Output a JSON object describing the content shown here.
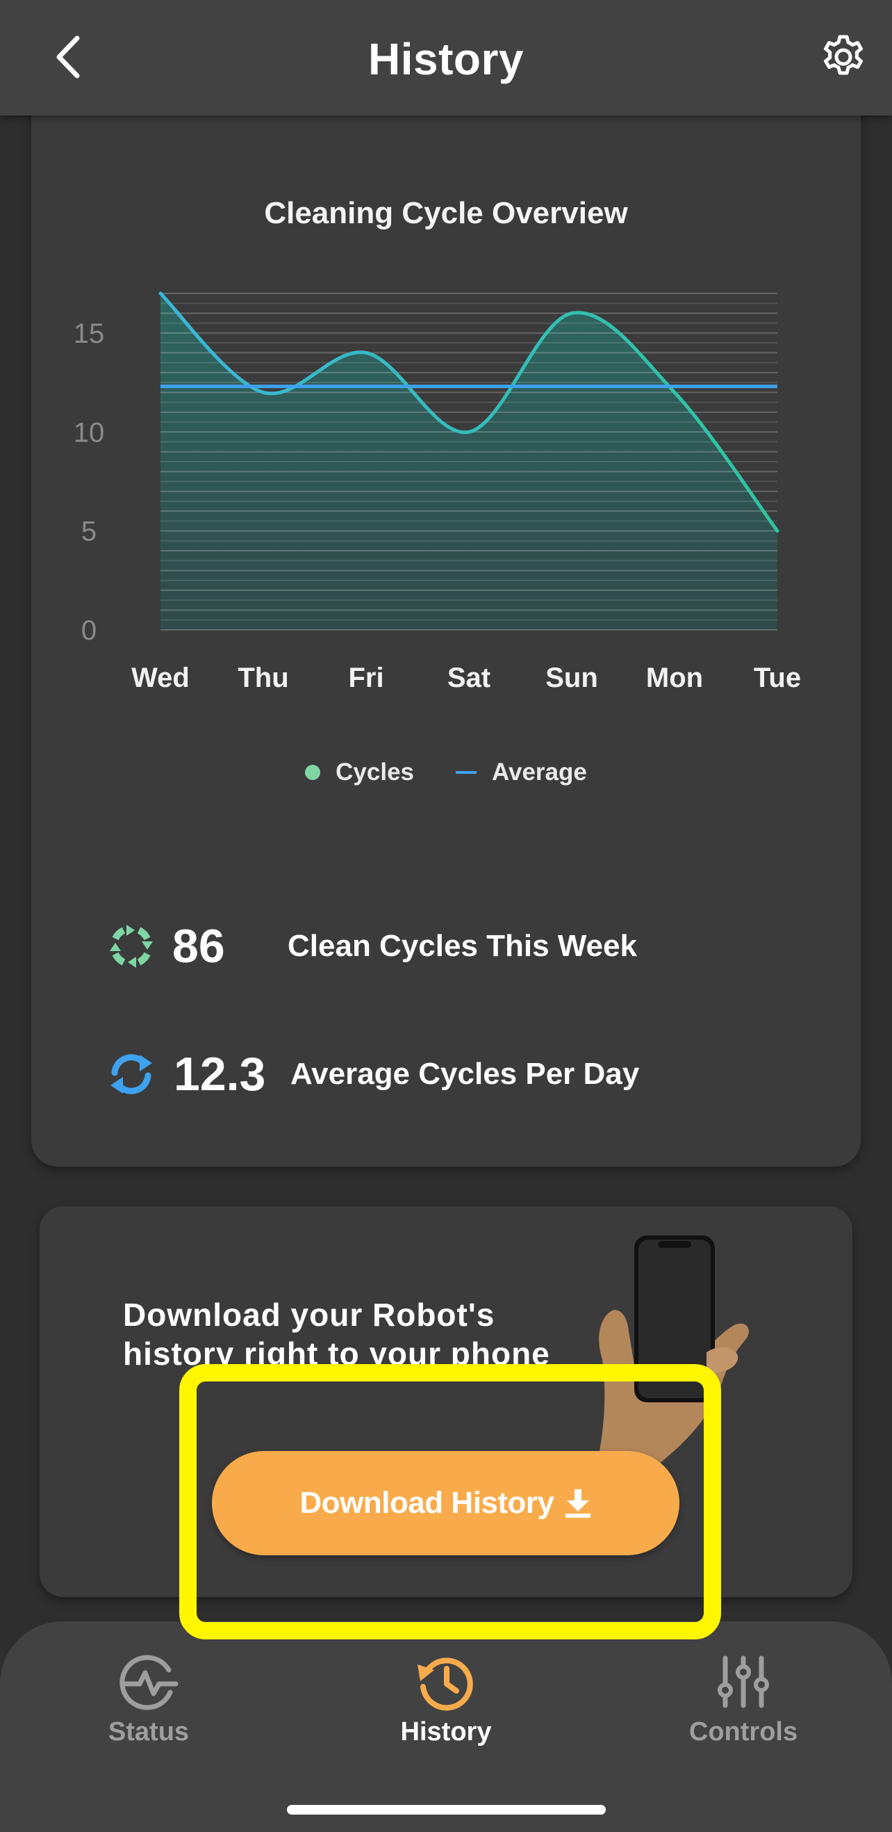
{
  "header": {
    "title": "History",
    "back_icon": "chevron-left-icon",
    "settings_icon": "gear-icon"
  },
  "chart_data": {
    "type": "line",
    "title": "Cleaning Cycle Overview",
    "categories": [
      "Wed",
      "Thu",
      "Fri",
      "Sat",
      "Sun",
      "Mon",
      "Tue"
    ],
    "series": [
      {
        "name": "Cycles",
        "values": [
          17,
          12,
          14,
          10,
          16,
          12,
          5
        ],
        "color": "#2ec4a0"
      },
      {
        "name": "Average",
        "values": [
          12.3,
          12.3,
          12.3,
          12.3,
          12.3,
          12.3,
          12.3
        ],
        "color": "#3ea2ef"
      }
    ],
    "yticks": [
      0,
      5,
      10,
      15
    ],
    "ylim": [
      0,
      17
    ],
    "grid": true,
    "legend": "bottom",
    "xlabel": "",
    "ylabel": ""
  },
  "legend": {
    "cycles": "Cycles",
    "average": "Average"
  },
  "stats": {
    "weekly_count": "86",
    "weekly_label": "Clean Cycles This Week",
    "daily_avg": "12.3",
    "daily_label": "Average Cycles Per Day"
  },
  "promo": {
    "text": "Download your Robot's history right to your phone",
    "button_label": "Download History",
    "button_icon": "download-icon",
    "highlight_color": "#fff600"
  },
  "nav": {
    "status": "Status",
    "history": "History",
    "controls": "Controls",
    "active_color": "#f9ab4b"
  },
  "colors": {
    "accent": "#f9ab4b",
    "cycles_line": "#2ec4a0",
    "average_line": "#3ea2ef"
  }
}
